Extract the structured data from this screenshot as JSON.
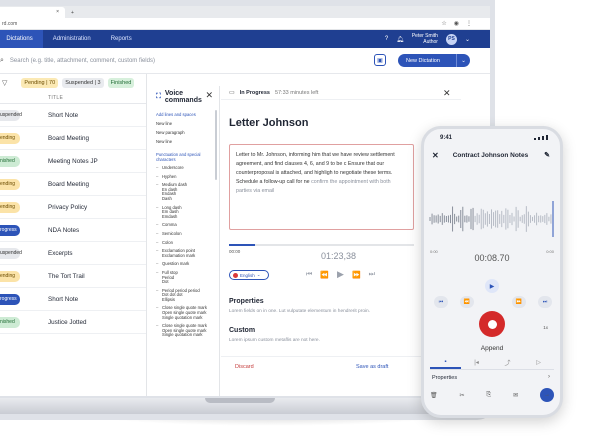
{
  "browser": {
    "tab_plus": "+",
    "tab_close": "×",
    "address": "rd.com",
    "icons": [
      "star-icon",
      "account-icon",
      "menu-icon"
    ]
  },
  "nav": {
    "items": [
      "ve",
      "Dictations",
      "Administration",
      "Reports"
    ],
    "active_index": 1,
    "help": "?",
    "user_name": "Peter Smith",
    "user_role": "Author",
    "avatar": "PS"
  },
  "search": {
    "placeholder": "Search (e.g. title, attachment, comment, custom fields)",
    "new_button": "New Dictation"
  },
  "filters": {
    "pending": "Pending | 70",
    "suspended": "Suspended | 3",
    "finished": "Finished"
  },
  "list": {
    "col_title": "TITLE",
    "rows": [
      {
        "status": "uspended",
        "kind": "suspended",
        "title": "Short Note"
      },
      {
        "status": "ending",
        "kind": "pending",
        "title": "Board Meeting"
      },
      {
        "status": "nished",
        "kind": "finished",
        "title": "Meeting Notes JP"
      },
      {
        "status": "ending",
        "kind": "pending",
        "title": "Board Meeting"
      },
      {
        "status": "ending",
        "kind": "pending",
        "title": "Privacy Policy"
      },
      {
        "status": "rogress",
        "kind": "progress",
        "title": "NDA Notes"
      },
      {
        "status": "uspended",
        "kind": "suspended",
        "title": "Excerpts"
      },
      {
        "status": "ending",
        "kind": "pending",
        "title": "The Tort Trail"
      },
      {
        "status": "rogress",
        "kind": "progress",
        "title": "Short Note"
      },
      {
        "status": "nished",
        "kind": "finished",
        "title": "Justice Jotted"
      }
    ]
  },
  "voice": {
    "title": "Voice commands",
    "sec1": "Add lines and spaces",
    "items1": [
      "New line",
      "New paragraph",
      "New line"
    ],
    "sec2": "Punctuation and special characters",
    "subs": [
      [
        "Underscore"
      ],
      [
        "Hyphen"
      ],
      [
        "Medium dash",
        "En dash",
        "Endash",
        "Dash"
      ],
      [
        "Long dash",
        "Em dash",
        "Emdash"
      ],
      [
        "Comma"
      ],
      [
        "Semicolon"
      ],
      [
        "Colon"
      ],
      [
        "Exclamation point",
        "Exclamation mark"
      ],
      [
        "Question mark"
      ],
      [
        "Full stop",
        "Period",
        "Dot"
      ],
      [
        "Period period period",
        "Dot dot dot",
        "Ellipsis"
      ],
      [
        "Close single quote mark",
        "Open single quote mark",
        "Single quotation mark"
      ],
      [
        "Close single quote mark",
        "Open single quote mark",
        "Single quotation mark"
      ]
    ]
  },
  "editor": {
    "status": "In Progress",
    "time_left": "57:33 minutes left",
    "title": "Letter Johnson",
    "body": "Letter to Mr. Johnson, informing him that we have review settlement agreement, and find clauses 4, 6, and 9 to be c Ensure that our counterproposal is attached, and highligh to negotiate these terms. Schedule a follow-up call for ne",
    "body_faded": "confirm the appointment with both parties via email",
    "time_start": "00:00",
    "timer": "01:23,38",
    "lang": "English",
    "props_title": "Properties",
    "props_text": "Lorem fields on in one. Lut vulputate elementum in hendrerit proin.",
    "custom_title": "Custom",
    "custom_text": "Lorem ipsum custom metaflis are not here.",
    "discard": "Discard",
    "save_draft": "Save as draft"
  },
  "phone": {
    "clock": "9:41",
    "title": "Contract Johnson Notes",
    "t_start": "0:00",
    "t_end": "0:00",
    "time": "00:08.70",
    "speed": "1x",
    "append": "Append",
    "properties": "Properties"
  }
}
